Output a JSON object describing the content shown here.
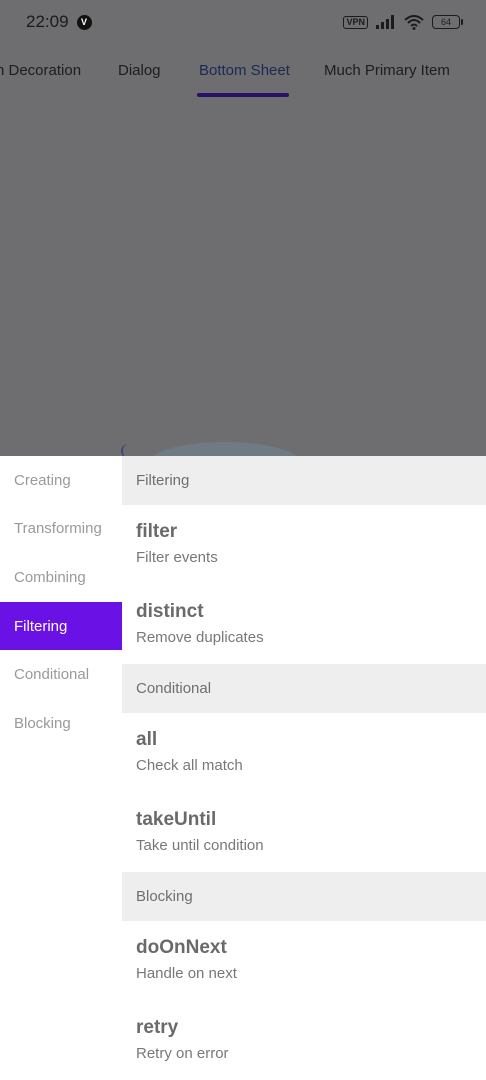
{
  "status_bar": {
    "time": "22:09",
    "app_badge": "V",
    "vpn": "VPN",
    "battery": "64",
    "icons": [
      "signal-icon",
      "wifi-icon",
      "battery-icon"
    ]
  },
  "tabs": [
    {
      "label": "n Decoration"
    },
    {
      "label": "Dialog"
    },
    {
      "label": "Bottom Sheet",
      "active": true
    },
    {
      "label": "Much Primary Item"
    }
  ],
  "sheet": {
    "categories": [
      {
        "label": "Creating"
      },
      {
        "label": "Transforming"
      },
      {
        "label": "Combining"
      },
      {
        "label": "Filtering",
        "active": true
      },
      {
        "label": "Conditional"
      },
      {
        "label": "Blocking"
      }
    ],
    "sections": [
      {
        "header": "Filtering",
        "items": [
          {
            "name": "filter",
            "desc": "Filter events"
          },
          {
            "name": "distinct",
            "desc": "Remove duplicates"
          }
        ]
      },
      {
        "header": "Conditional",
        "items": [
          {
            "name": "all",
            "desc": "Check all match"
          },
          {
            "name": "takeUntil",
            "desc": "Take until condition"
          }
        ]
      },
      {
        "header": "Blocking",
        "items": [
          {
            "name": "doOnNext",
            "desc": "Handle on next"
          },
          {
            "name": "retry",
            "desc": "Retry on error"
          }
        ]
      }
    ]
  },
  "colors": {
    "accent": "#6a12e6",
    "scrim": "#6e6e70",
    "section_bg": "#eeeeee",
    "tab_indicator": "#2b1166"
  }
}
